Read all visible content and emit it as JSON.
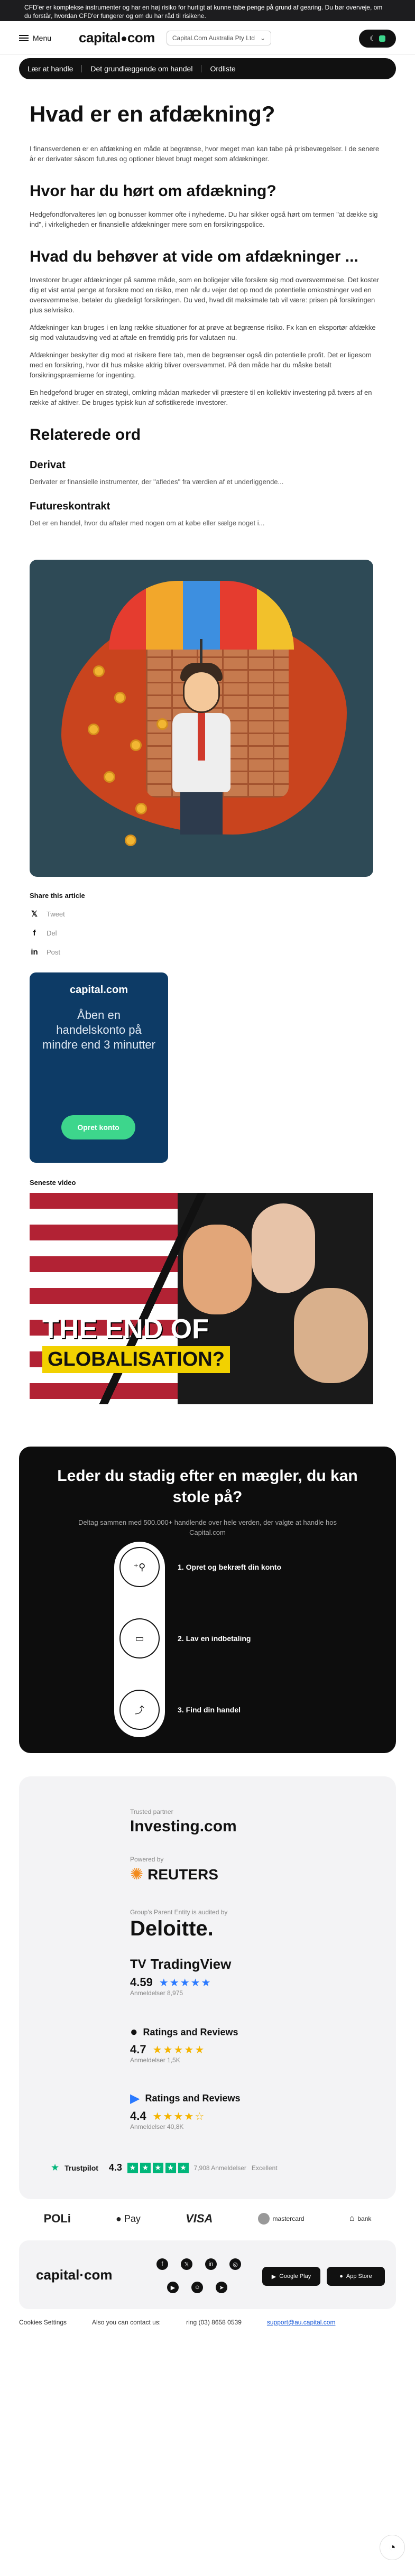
{
  "risk_warning": "CFD'er er komplekse instrumenter og har en høj risiko for hurtigt at kunne tabe penge på grund af gearing. Du bør overveje, om du forstår, hvordan CFD'er fungerer og om du har råd til risikene.",
  "header": {
    "menu_label": "Menu",
    "logo_left": "capital",
    "logo_right": "com",
    "entity_label": "Capital.Com Australia Pty Ltd",
    "entity_chevron": "⌄"
  },
  "subnav": [
    "Lær at handle",
    "Det grundlæggende om handel",
    "Ordliste"
  ],
  "article": {
    "title": "Hvad er en afdækning?",
    "intro": "I finansverdenen er en afdækning en måde at begrænse, hvor meget man kan tabe på prisbevægelser. I de senere år er derivater såsom futures og optioner blevet brugt meget som afdækninger.",
    "h2_heard": "Hvor har du hørt om afdækning?",
    "p_heard": "Hedgefondforvalteres løn og bonusser kommer ofte i nyhederne. Du har sikker også hørt om termen \"at dække sig ind\", i virkeligheden er finansielle afdækninger mere som en forsikringspolice.",
    "h2_need": "Hvad du behøver at vide om afdækninger ...",
    "p_need1": "Investorer bruger afdækninger på samme måde, som en boligejer ville forsikre sig mod oversvømmelse. Det koster dig et vist antal penge at forsikre mod en risiko, men når du vejer det op mod de potentielle omkostninger ved en oversvømmelse, betaler du glædeligt forsikringen. Du ved, hvad dit maksimale tab vil være: prisen på forsikringen plus selvrisiko.",
    "p_need2": "Afdækninger kan bruges i en lang række situationer for at prøve at begrænse risiko. Fx kan en eksportør afdække sig mod valutaudsving ved at aftale en fremtidig pris for valutaen nu.",
    "p_need3": "Afdækninger beskytter dig mod at risikere flere tab, men de begrænser også din potentielle profit. Det er ligesom med en forsikring, hvor dit hus måske aldrig bliver oversvømmet. På den måde har du måske betalt forsikringspræmierne for ingenting.",
    "p_need4": "En hedgefond bruger en strategi, omkring mådan markeder vil præstere til en kollektiv investering på tværs af en række af aktiver. De bruges typisk kun af sofistikerede investorer.",
    "h2_related": "Relaterede ord",
    "rel1_title": "Derivat",
    "rel1_text": "Derivater er finansielle instrumenter, der \"afledes\" fra værdien af et underliggende...",
    "rel2_title": "Futureskontrakt",
    "rel2_text": "Det er en handel, hvor du aftaler med nogen om at købe eller sælge noget i..."
  },
  "share": {
    "title": "Share this article",
    "items": [
      "Tweet",
      "Del",
      "Post"
    ],
    "icons": [
      "x-icon",
      "facebook-icon",
      "linkedin-icon"
    ]
  },
  "promo": {
    "logo": "capital.com",
    "text": "Åben en handelskonto på mindre end 3 minutter",
    "button": "Opret konto"
  },
  "video": {
    "label": "Seneste video",
    "caption_line1": "THE END OF",
    "caption_line2": "GLOBALISATION?"
  },
  "broker": {
    "title": "Leder du stadig efter en mægler, du kan stole på?",
    "subtitle": "Deltag sammen med 500.000+ handlende over hele verden, der valgte at handle hos Capital.com",
    "steps": [
      "1. Opret og bekræft din konto",
      "2. Lav en indbetaling",
      "3. Find din handel"
    ]
  },
  "trust": {
    "trusted_partner": "Trusted partner",
    "investing": "Investing.com",
    "powered_by": "Powered by",
    "reuters": "REUTERS",
    "audited": "Group's Parent Entity is audited by",
    "deloitte": "Deloitte.",
    "tradingview": "TradingView",
    "tv_rating": "4.59",
    "tv_reviews": "Anmeldelser 8,975",
    "apple_title": "Ratings and Reviews",
    "apple_rating": "4.7",
    "apple_reviews": "Anmeldelser 1,5K",
    "google_title": "Ratings and Reviews",
    "google_rating": "4.4",
    "google_reviews": "Anmeldelser 40,8K",
    "trustpilot": "Trustpilot",
    "tp_rating": "4.3",
    "tp_reviews": "7,908 Anmeldelser",
    "tp_label": "Excellent"
  },
  "payments": [
    "POLi",
    "Pay",
    "VISA",
    "mastercard",
    "bank"
  ],
  "footer": {
    "logo": "capital·com",
    "google_play": "Google Play",
    "app_store": "App Store",
    "cookies": "Cookies Settings",
    "contact_prefix": "Also you can contact us:",
    "phone": "ring (03) 8658 0539",
    "email": "support@au.capital.com"
  }
}
